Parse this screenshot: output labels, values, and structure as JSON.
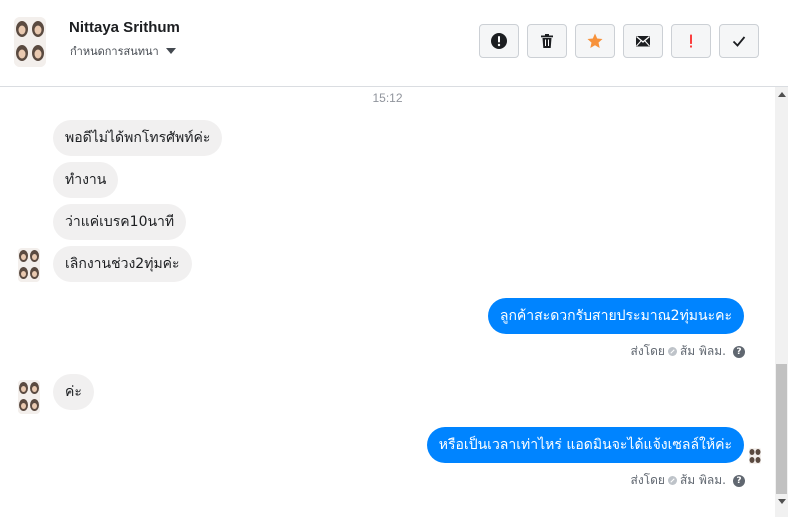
{
  "header": {
    "contact_name": "Nittaya Srithum",
    "label_dropdown": "กำหนดการสนทนา",
    "toolbar": [
      {
        "name": "mark-spam",
        "icon": "exclamation-circle-icon"
      },
      {
        "name": "delete",
        "icon": "trash-icon"
      },
      {
        "name": "star",
        "icon": "star-icon",
        "color": "#f7923b"
      },
      {
        "name": "mark-unread",
        "icon": "envelope-icon"
      },
      {
        "name": "mark-important",
        "icon": "exclamation-icon",
        "color": "#fa3e3e"
      },
      {
        "name": "mark-done",
        "icon": "check-icon"
      }
    ]
  },
  "conversation": {
    "timestamp": "15:12",
    "incoming_1": [
      "พอดีไม่ได้พกโทรศัพท์ค่ะ",
      "ทำงาน",
      "ว่าแค่เบรค10นาที",
      "เลิกงานช่วง2ทุ่มค่ะ"
    ],
    "outgoing_1": "ลูกค้าสะดวกรับสายประมาณ2ทุ่มนะคะ",
    "meta_1": {
      "sent_by": "ส่งโดย",
      "agent": "ส้ม พิลม."
    },
    "incoming_2": "ค่ะ",
    "outgoing_2": "หรือเป็นเวลาเท่าไหร่ แอดมินจะได้แจ้งเซลล์ให้ค่ะ",
    "meta_2": {
      "sent_by": "ส่งโดย",
      "agent": "ส้ม พิลม."
    }
  },
  "colors": {
    "outgoing_bubble": "#0084ff",
    "incoming_bubble": "#f1f0f0",
    "star": "#f7923b",
    "important": "#fa3e3e"
  }
}
